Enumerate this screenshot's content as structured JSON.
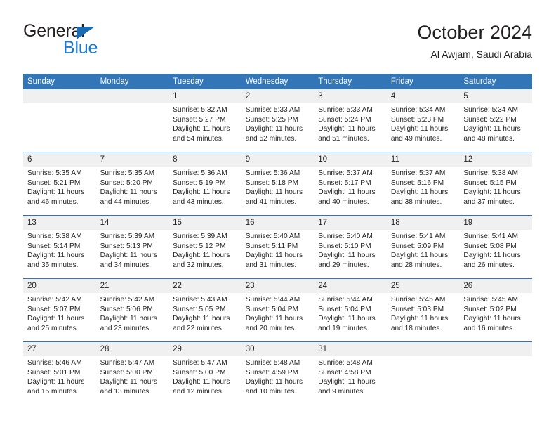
{
  "brand": {
    "name_part1": "General",
    "name_part2": "Blue",
    "triangle_color": "#1b6cb3",
    "blue_color": "#1b7ad1"
  },
  "header": {
    "title": "October 2024",
    "subtitle": "Al Awjam, Saudi Arabia"
  },
  "theme": {
    "header_bg": "#3276b8",
    "daynum_bg": "#f0f0f0",
    "row_divider": "#3276b8",
    "text": "#231f20"
  },
  "weekdays": [
    "Sunday",
    "Monday",
    "Tuesday",
    "Wednesday",
    "Thursday",
    "Friday",
    "Saturday"
  ],
  "weeks": [
    [
      {
        "day": "",
        "sunrise": "",
        "sunset": "",
        "daylight1": "",
        "daylight2": "",
        "empty": true
      },
      {
        "day": "",
        "sunrise": "",
        "sunset": "",
        "daylight1": "",
        "daylight2": "",
        "empty": true
      },
      {
        "day": "1",
        "sunrise": "Sunrise: 5:32 AM",
        "sunset": "Sunset: 5:27 PM",
        "daylight1": "Daylight: 11 hours",
        "daylight2": "and 54 minutes."
      },
      {
        "day": "2",
        "sunrise": "Sunrise: 5:33 AM",
        "sunset": "Sunset: 5:25 PM",
        "daylight1": "Daylight: 11 hours",
        "daylight2": "and 52 minutes."
      },
      {
        "day": "3",
        "sunrise": "Sunrise: 5:33 AM",
        "sunset": "Sunset: 5:24 PM",
        "daylight1": "Daylight: 11 hours",
        "daylight2": "and 51 minutes."
      },
      {
        "day": "4",
        "sunrise": "Sunrise: 5:34 AM",
        "sunset": "Sunset: 5:23 PM",
        "daylight1": "Daylight: 11 hours",
        "daylight2": "and 49 minutes."
      },
      {
        "day": "5",
        "sunrise": "Sunrise: 5:34 AM",
        "sunset": "Sunset: 5:22 PM",
        "daylight1": "Daylight: 11 hours",
        "daylight2": "and 48 minutes."
      }
    ],
    [
      {
        "day": "6",
        "sunrise": "Sunrise: 5:35 AM",
        "sunset": "Sunset: 5:21 PM",
        "daylight1": "Daylight: 11 hours",
        "daylight2": "and 46 minutes."
      },
      {
        "day": "7",
        "sunrise": "Sunrise: 5:35 AM",
        "sunset": "Sunset: 5:20 PM",
        "daylight1": "Daylight: 11 hours",
        "daylight2": "and 44 minutes."
      },
      {
        "day": "8",
        "sunrise": "Sunrise: 5:36 AM",
        "sunset": "Sunset: 5:19 PM",
        "daylight1": "Daylight: 11 hours",
        "daylight2": "and 43 minutes."
      },
      {
        "day": "9",
        "sunrise": "Sunrise: 5:36 AM",
        "sunset": "Sunset: 5:18 PM",
        "daylight1": "Daylight: 11 hours",
        "daylight2": "and 41 minutes."
      },
      {
        "day": "10",
        "sunrise": "Sunrise: 5:37 AM",
        "sunset": "Sunset: 5:17 PM",
        "daylight1": "Daylight: 11 hours",
        "daylight2": "and 40 minutes."
      },
      {
        "day": "11",
        "sunrise": "Sunrise: 5:37 AM",
        "sunset": "Sunset: 5:16 PM",
        "daylight1": "Daylight: 11 hours",
        "daylight2": "and 38 minutes."
      },
      {
        "day": "12",
        "sunrise": "Sunrise: 5:38 AM",
        "sunset": "Sunset: 5:15 PM",
        "daylight1": "Daylight: 11 hours",
        "daylight2": "and 37 minutes."
      }
    ],
    [
      {
        "day": "13",
        "sunrise": "Sunrise: 5:38 AM",
        "sunset": "Sunset: 5:14 PM",
        "daylight1": "Daylight: 11 hours",
        "daylight2": "and 35 minutes."
      },
      {
        "day": "14",
        "sunrise": "Sunrise: 5:39 AM",
        "sunset": "Sunset: 5:13 PM",
        "daylight1": "Daylight: 11 hours",
        "daylight2": "and 34 minutes."
      },
      {
        "day": "15",
        "sunrise": "Sunrise: 5:39 AM",
        "sunset": "Sunset: 5:12 PM",
        "daylight1": "Daylight: 11 hours",
        "daylight2": "and 32 minutes."
      },
      {
        "day": "16",
        "sunrise": "Sunrise: 5:40 AM",
        "sunset": "Sunset: 5:11 PM",
        "daylight1": "Daylight: 11 hours",
        "daylight2": "and 31 minutes."
      },
      {
        "day": "17",
        "sunrise": "Sunrise: 5:40 AM",
        "sunset": "Sunset: 5:10 PM",
        "daylight1": "Daylight: 11 hours",
        "daylight2": "and 29 minutes."
      },
      {
        "day": "18",
        "sunrise": "Sunrise: 5:41 AM",
        "sunset": "Sunset: 5:09 PM",
        "daylight1": "Daylight: 11 hours",
        "daylight2": "and 28 minutes."
      },
      {
        "day": "19",
        "sunrise": "Sunrise: 5:41 AM",
        "sunset": "Sunset: 5:08 PM",
        "daylight1": "Daylight: 11 hours",
        "daylight2": "and 26 minutes."
      }
    ],
    [
      {
        "day": "20",
        "sunrise": "Sunrise: 5:42 AM",
        "sunset": "Sunset: 5:07 PM",
        "daylight1": "Daylight: 11 hours",
        "daylight2": "and 25 minutes."
      },
      {
        "day": "21",
        "sunrise": "Sunrise: 5:42 AM",
        "sunset": "Sunset: 5:06 PM",
        "daylight1": "Daylight: 11 hours",
        "daylight2": "and 23 minutes."
      },
      {
        "day": "22",
        "sunrise": "Sunrise: 5:43 AM",
        "sunset": "Sunset: 5:05 PM",
        "daylight1": "Daylight: 11 hours",
        "daylight2": "and 22 minutes."
      },
      {
        "day": "23",
        "sunrise": "Sunrise: 5:44 AM",
        "sunset": "Sunset: 5:04 PM",
        "daylight1": "Daylight: 11 hours",
        "daylight2": "and 20 minutes."
      },
      {
        "day": "24",
        "sunrise": "Sunrise: 5:44 AM",
        "sunset": "Sunset: 5:04 PM",
        "daylight1": "Daylight: 11 hours",
        "daylight2": "and 19 minutes."
      },
      {
        "day": "25",
        "sunrise": "Sunrise: 5:45 AM",
        "sunset": "Sunset: 5:03 PM",
        "daylight1": "Daylight: 11 hours",
        "daylight2": "and 18 minutes."
      },
      {
        "day": "26",
        "sunrise": "Sunrise: 5:45 AM",
        "sunset": "Sunset: 5:02 PM",
        "daylight1": "Daylight: 11 hours",
        "daylight2": "and 16 minutes."
      }
    ],
    [
      {
        "day": "27",
        "sunrise": "Sunrise: 5:46 AM",
        "sunset": "Sunset: 5:01 PM",
        "daylight1": "Daylight: 11 hours",
        "daylight2": "and 15 minutes."
      },
      {
        "day": "28",
        "sunrise": "Sunrise: 5:47 AM",
        "sunset": "Sunset: 5:00 PM",
        "daylight1": "Daylight: 11 hours",
        "daylight2": "and 13 minutes."
      },
      {
        "day": "29",
        "sunrise": "Sunrise: 5:47 AM",
        "sunset": "Sunset: 5:00 PM",
        "daylight1": "Daylight: 11 hours",
        "daylight2": "and 12 minutes."
      },
      {
        "day": "30",
        "sunrise": "Sunrise: 5:48 AM",
        "sunset": "Sunset: 4:59 PM",
        "daylight1": "Daylight: 11 hours",
        "daylight2": "and 10 minutes."
      },
      {
        "day": "31",
        "sunrise": "Sunrise: 5:48 AM",
        "sunset": "Sunset: 4:58 PM",
        "daylight1": "Daylight: 11 hours",
        "daylight2": "and 9 minutes."
      },
      {
        "day": "",
        "sunrise": "",
        "sunset": "",
        "daylight1": "",
        "daylight2": "",
        "empty": true
      },
      {
        "day": "",
        "sunrise": "",
        "sunset": "",
        "daylight1": "",
        "daylight2": "",
        "empty": true
      }
    ]
  ]
}
